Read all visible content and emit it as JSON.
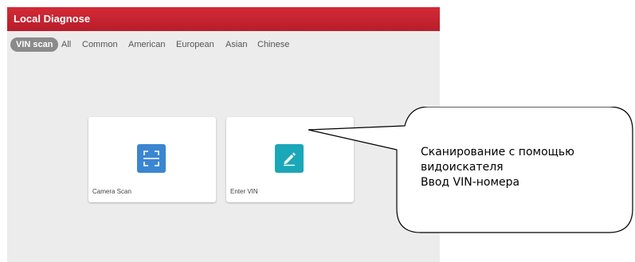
{
  "header": {
    "title": "Local Diagnose"
  },
  "tabs": [
    {
      "label": "VIN scan",
      "active": true
    },
    {
      "label": "All"
    },
    {
      "label": "Common"
    },
    {
      "label": "American"
    },
    {
      "label": "European"
    },
    {
      "label": "Asian"
    },
    {
      "label": "Chinese"
    }
  ],
  "cards": [
    {
      "label": "Camera Scan",
      "icon": "scan-frame-icon",
      "color": "#3b86d1"
    },
    {
      "label": "Enter VIN",
      "icon": "pencil-icon",
      "color": "#1aa7b8"
    }
  ],
  "callout": {
    "lines": [
      "Сканирование с помощью",
      "видоискателя",
      "Ввод VIN-номера"
    ]
  },
  "colors": {
    "header": "#c8202e",
    "background": "#ececec",
    "active_tab": "#8b8b8b"
  }
}
